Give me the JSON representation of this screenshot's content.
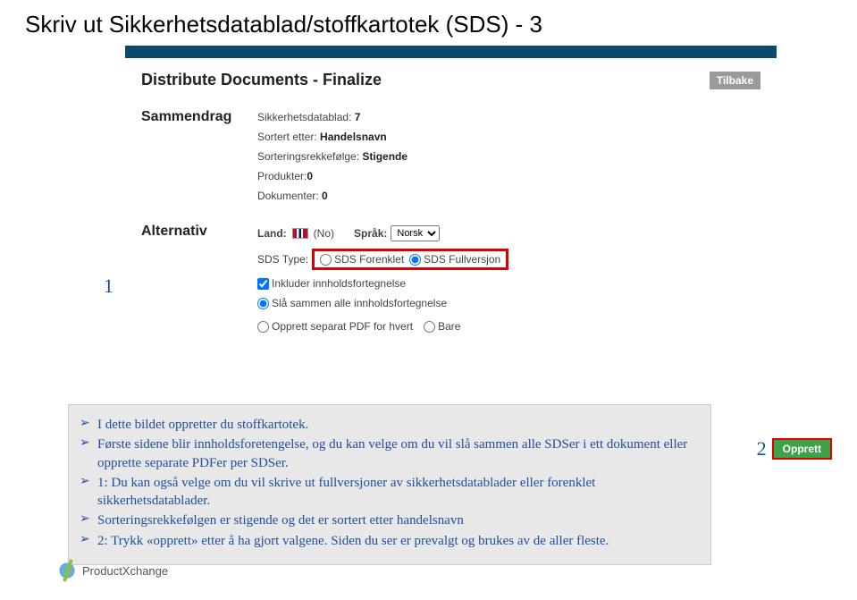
{
  "page_title": "Skriv ut Sikkerhetsdatablad/stoffkartotek (SDS) - 3",
  "app": {
    "heading": "Distribute Documents - Finalize",
    "back_btn": "Tilbake"
  },
  "summary": {
    "label": "Sammendrag",
    "lines": {
      "sds": {
        "label": "Sikkerhetsdatablad: ",
        "value": "7"
      },
      "sorted": {
        "label": "Sortert etter: ",
        "value": "Handelsnavn"
      },
      "order": {
        "label": "Sorteringsrekkefølge: ",
        "value": "Stigende"
      },
      "products": {
        "label": "Produkter:",
        "value": "0"
      },
      "documents": {
        "label": "Dokumenter: ",
        "value": "0"
      }
    }
  },
  "alternative": {
    "label": "Alternativ",
    "land_label": "Land:",
    "land_value": "(No)",
    "sprak_label": "Språk:",
    "sprak_value": "Norsk",
    "sds_type_label": "SDS Type:",
    "opt_forenklet": "SDS Forenklet",
    "opt_fullversjon": "SDS Fullversjon",
    "include_toc": "Inkluder innholdsfortegnelse",
    "pdf_merge": "Slå sammen alle innholdsfortegnelse",
    "pdf_separate": "Opprett separat PDF for hvert",
    "pdf_bare": "Bare"
  },
  "markers": {
    "one": "1",
    "two": "2",
    "opprett": "Opprett"
  },
  "notes": {
    "b1": "I dette bildet oppretter du stoffkartotek.",
    "b2": "Første sidene blir innholdsforetengelse, og du kan velge om du vil slå sammen alle SDSer i ett dokument eller opprette separate PDFer per SDSer.",
    "b3": "1: Du kan også velge om du vil skrive ut fullversjoner av sikkerhetsdatablader eller forenklet sikkerhetsdatablader.",
    "b4": "Sorteringsrekkefølgen er stigende og det er sortert etter handelsnavn",
    "b5": "2: Trykk «opprett» etter å ha gjort valgene. Siden du ser er prevalgt og brukes av de aller fleste."
  },
  "logo_text": "ProductXchange"
}
